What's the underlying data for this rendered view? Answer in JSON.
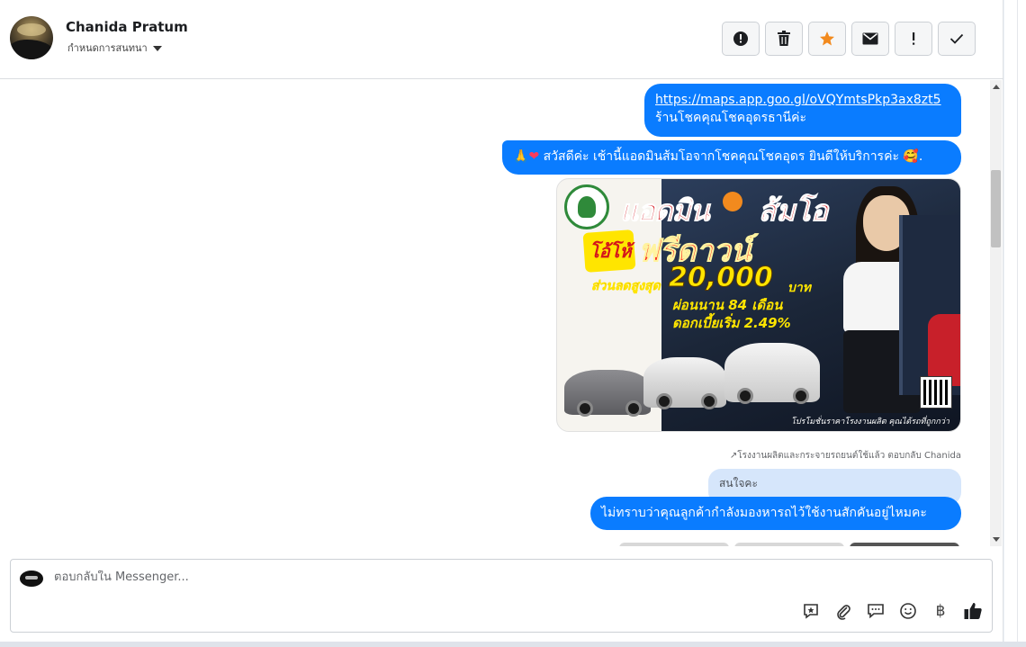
{
  "header": {
    "contact_name": "Chanida Pratum",
    "assign_label": "กำหนดการสนทนา",
    "toolbar": [
      {
        "icon": "alert-circle-icon",
        "label": "!"
      },
      {
        "icon": "trash-icon",
        "label": ""
      },
      {
        "icon": "star-icon",
        "label": ""
      },
      {
        "icon": "envelope-icon",
        "label": ""
      },
      {
        "icon": "exclamation-icon",
        "label": "!"
      },
      {
        "icon": "checkmark-icon",
        "label": ""
      }
    ],
    "star_color": "#f28a1e"
  },
  "messages": {
    "msg1_link": "https://maps.app.goo.gl/oVQYmtsPkp3ax8zt5",
    "msg1_text": "ร้านโชคคุณโชคอุดรธานีค่ะ",
    "msg2_text": "สวัสดีค่ะ เช้านี้แอดมินส้มโอจากโชคคุณโชคอุดร ยินดีให้บริการค่ะ",
    "msg2_end": ".",
    "ad_image": {
      "title_left": "แอดมิน",
      "title_right": "ส้มโอ",
      "promo_burst": "โอ้โห้",
      "promo_main": "ฟรีดาวน์",
      "discount_label": "ส่วนลดสูงสุด",
      "discount_amount": "20,000",
      "discount_unit": "บาท",
      "term": "ผ่อนนาน 84 เดือน",
      "rate": "ดอกเบี้ยเริ่ม 2.49%",
      "footer": "โปรโมชั่นราคาโรงงานผลิต คุณได้รถที่ถูกกว่า"
    },
    "reply_ref": "โรงงานผลิตและกระจายรถยนต์ใช้แล้ว ตอบกลับ Chanida",
    "quoted_text": "สนใจคะ",
    "msg4_text": "ไม่ทราบว่าคุณลูกค้ากำลังมองหารถไว้ใช้งานสักคันอยู่ไหมคะ",
    "bubble_color": "#0a7cff"
  },
  "composer": {
    "placeholder": "ตอบกลับใน Messenger...",
    "tools": [
      {
        "icon": "saved-reply-icon"
      },
      {
        "icon": "paperclip-icon"
      },
      {
        "icon": "chat-bubbles-icon"
      },
      {
        "icon": "emoji-icon"
      },
      {
        "icon": "baht-icon",
        "label": "฿"
      },
      {
        "icon": "thumbs-up-icon"
      }
    ]
  }
}
